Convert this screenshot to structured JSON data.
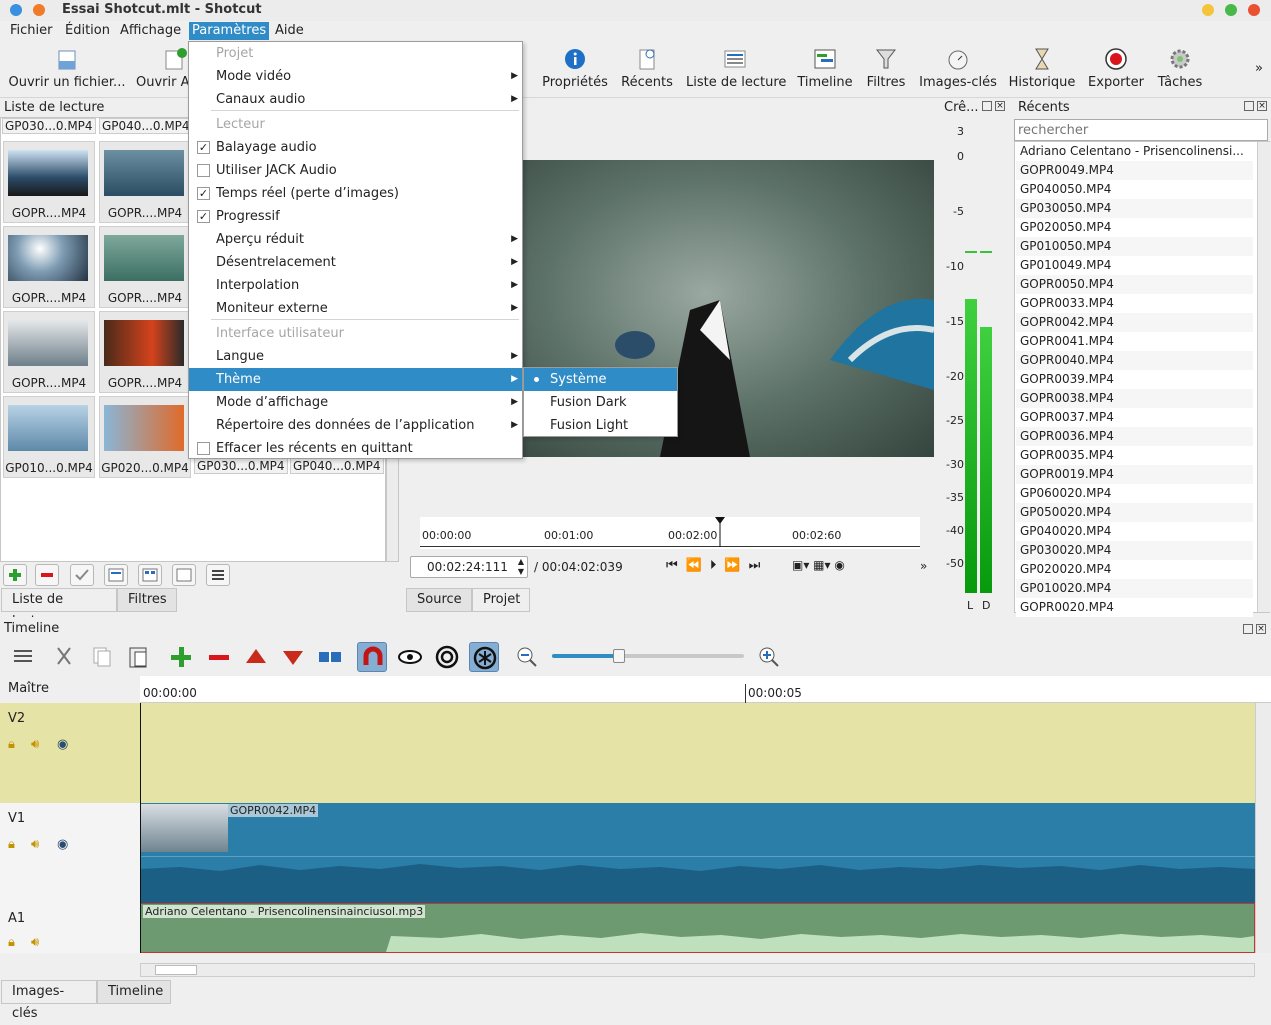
{
  "window": {
    "title": "Essai Shotcut.mlt - Shotcut"
  },
  "menubar": [
    "Fichier",
    "Édition",
    "Affichage",
    "Paramètres",
    "Aide"
  ],
  "toolbar": {
    "left": [
      "Ouvrir un fichier...",
      "Ouvrir A"
    ],
    "right": [
      "Propriétés",
      "Récents",
      "Liste de lecture",
      "Timeline",
      "Filtres",
      "Images-clés",
      "Historique",
      "Exporter",
      "Tâches"
    ],
    "more": "»"
  },
  "playlist": {
    "title": "Liste de lecture",
    "top_strip": [
      "GP030...0.MP4",
      "GP040...0.MP4"
    ],
    "thumbs": [
      "GOPR....MP4",
      "GOPR....MP4",
      "GOPR....MP4",
      "GOPR....MP4",
      "GOPR....MP4",
      "GOPR....MP4",
      "GP010...0.MP4",
      "GP020...0.MP4"
    ],
    "bottom_strip": [
      "GP030...0.MP4",
      "GP040...0.MP4"
    ],
    "tabs": [
      "Liste de lecture",
      "Filtres"
    ]
  },
  "params_menu": {
    "items": [
      {
        "label": "Projet",
        "type": "header"
      },
      {
        "label": "Mode vidéo",
        "type": "submenu"
      },
      {
        "label": "Canaux audio",
        "type": "submenu"
      },
      {
        "label": "Lecteur",
        "type": "header"
      },
      {
        "label": "Balayage audio",
        "type": "check",
        "checked": true
      },
      {
        "label": "Utiliser JACK Audio",
        "type": "check",
        "checked": false
      },
      {
        "label": "Temps réel (perte d’images)",
        "type": "check",
        "checked": true
      },
      {
        "label": "Progressif",
        "type": "check",
        "checked": true
      },
      {
        "label": "Aperçu réduit",
        "type": "submenu"
      },
      {
        "label": "Désentrelacement",
        "type": "submenu"
      },
      {
        "label": "Interpolation",
        "type": "submenu"
      },
      {
        "label": "Moniteur externe",
        "type": "submenu"
      },
      {
        "label": "Interface utilisateur",
        "type": "header"
      },
      {
        "label": "Langue",
        "type": "submenu"
      },
      {
        "label": "Thème",
        "type": "submenu",
        "highlighted": true
      },
      {
        "label": "Mode d’affichage",
        "type": "submenu"
      },
      {
        "label": "Répertoire des données de l’application",
        "type": "submenu"
      },
      {
        "label": "Effacer les récents en quittant",
        "type": "check",
        "checked": false
      }
    ],
    "checkmark": "✓",
    "arrow": "▶"
  },
  "theme_submenu": [
    {
      "label": "Système",
      "selected": true
    },
    {
      "label": "Fusion Dark",
      "selected": false
    },
    {
      "label": "Fusion Light",
      "selected": false
    }
  ],
  "player": {
    "ruler": [
      "00:00:00",
      "00:01:00",
      "00:02:00",
      "00:02:60"
    ],
    "current_time": "00:02:24:111",
    "duration": "/ 00:04:02:039",
    "tabs": [
      "Source",
      "Projet"
    ],
    "playhead_fraction": 0.6
  },
  "audio_meter": {
    "title": "Crê...",
    "scale": [
      "3",
      "0",
      "-5",
      "-10",
      "-15",
      "-20",
      "-25",
      "-30",
      "-35",
      "-40",
      "-50"
    ],
    "channels": [
      "L",
      "D"
    ],
    "levels": [
      -13,
      -15.5
    ]
  },
  "recents": {
    "title": "Récents",
    "search_placeholder": "rechercher",
    "items": [
      "Adriano Celentano - Prisencolinensi...",
      "GOPR0049.MP4",
      "GP040050.MP4",
      "GP030050.MP4",
      "GP020050.MP4",
      "GP010050.MP4",
      "GP010049.MP4",
      "GOPR0050.MP4",
      "GOPR0033.MP4",
      "GOPR0042.MP4",
      "GOPR0041.MP4",
      "GOPR0040.MP4",
      "GOPR0039.MP4",
      "GOPR0038.MP4",
      "GOPR0037.MP4",
      "GOPR0036.MP4",
      "GOPR0035.MP4",
      "GOPR0019.MP4",
      "GP060020.MP4",
      "GP050020.MP4",
      "GP040020.MP4",
      "GP030020.MP4",
      "GP020020.MP4",
      "GP010020.MP4",
      "GOPR0020.MP4"
    ]
  },
  "timeline": {
    "title": "Timeline",
    "master": "Maître",
    "ruler": [
      "00:00:00",
      "00:00:05"
    ],
    "tracks": [
      {
        "name": "V2"
      },
      {
        "name": "V1",
        "clip": "GOPR0042.MP4"
      },
      {
        "name": "A1",
        "clip": "Adriano Celentano - Prisencolinensinainciusol.mp3"
      }
    ],
    "zoom_fraction": 0.35,
    "bottom_tabs": [
      "Images-clés",
      "Timeline"
    ]
  },
  "colors": {
    "accent": "#308cc6",
    "video_track": "#2a7ea8",
    "audio_clip": "#bfe0bd",
    "v2_bg": "#e5e3a6"
  }
}
